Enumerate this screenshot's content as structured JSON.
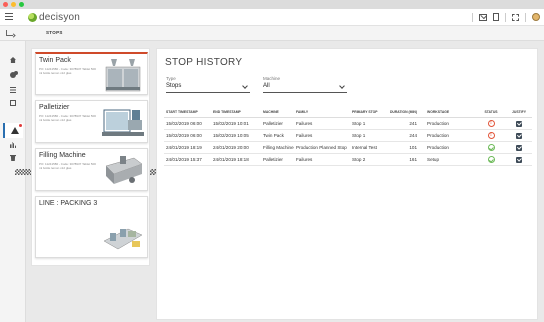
{
  "app": {
    "logo_text": "decisyon"
  },
  "breadcrumb": {
    "label": "STOPS"
  },
  "rail": {
    "items": [
      "home-icon",
      "gears-icon",
      "list-icon",
      "check-icon",
      "grid-icon",
      "alert-icon",
      "bars-icon",
      "trash-icon"
    ],
    "active": "alert-icon"
  },
  "machines": [
    {
      "name": "Twin Pack",
      "meta": "PO: 11241580 - Code: 3078937 Tablet 500 ml bottle lemon x12 glas",
      "active": true
    },
    {
      "name": "Palletizier",
      "meta": "PO: 11241580 - Code: 3078937 Tablet 500 ml bottle lemon x12 glas",
      "active": false
    },
    {
      "name": "Filling Machine",
      "meta": "PO: 11241580 - Code: 3078937 Tablet 500 ml bottle lemon x12 glas",
      "active": false
    },
    {
      "name": "LINE : PACKING 3",
      "meta": "",
      "active": false
    }
  ],
  "stop_history": {
    "title": "STOP HISTORY",
    "filters": {
      "type": {
        "label": "Type",
        "value": "Stops"
      },
      "machine": {
        "label": "Machine",
        "value": "All"
      }
    },
    "columns": [
      "START TIMESTAMP",
      "END TIMESTAMP",
      "MACHINE",
      "FAMILY",
      "PRIMARY STOP",
      "DURATION (MIN)",
      "WORKSTAGE",
      "STATUS",
      "JUSTIFY"
    ],
    "rows": [
      {
        "start": "15/02/2019 06:00",
        "end": "15/02/2019 10:01",
        "machine": "Palletizier",
        "family": "Failures",
        "primary_stop": "Stop 1",
        "duration": "241",
        "workstage": "Production",
        "status": "warning",
        "justify": true
      },
      {
        "start": "15/02/2019 06:00",
        "end": "15/02/2019 10:05",
        "machine": "Twin Pack",
        "family": "Failures",
        "primary_stop": "Stop 1",
        "duration": "244",
        "workstage": "Production",
        "status": "warning",
        "justify": true
      },
      {
        "start": "24/01/2019 18:19",
        "end": "24/01/2019 20:00",
        "machine": "Filling Machine",
        "family": "Production Planned Stop",
        "primary_stop": "Internal Test",
        "duration": "101",
        "workstage": "Production",
        "status": "ok",
        "justify": true
      },
      {
        "start": "24/01/2019 15:37",
        "end": "24/01/2019 18:18",
        "machine": "Palletizier",
        "family": "Failures",
        "primary_stop": "Stop 2",
        "duration": "161",
        "workstage": "Setup",
        "status": "ok",
        "justify": true
      }
    ]
  },
  "colors": {
    "accent": "#cf4a2a",
    "active_rail": "#2a6fb0",
    "warning": "#e2553a",
    "ok": "#6dba59"
  }
}
